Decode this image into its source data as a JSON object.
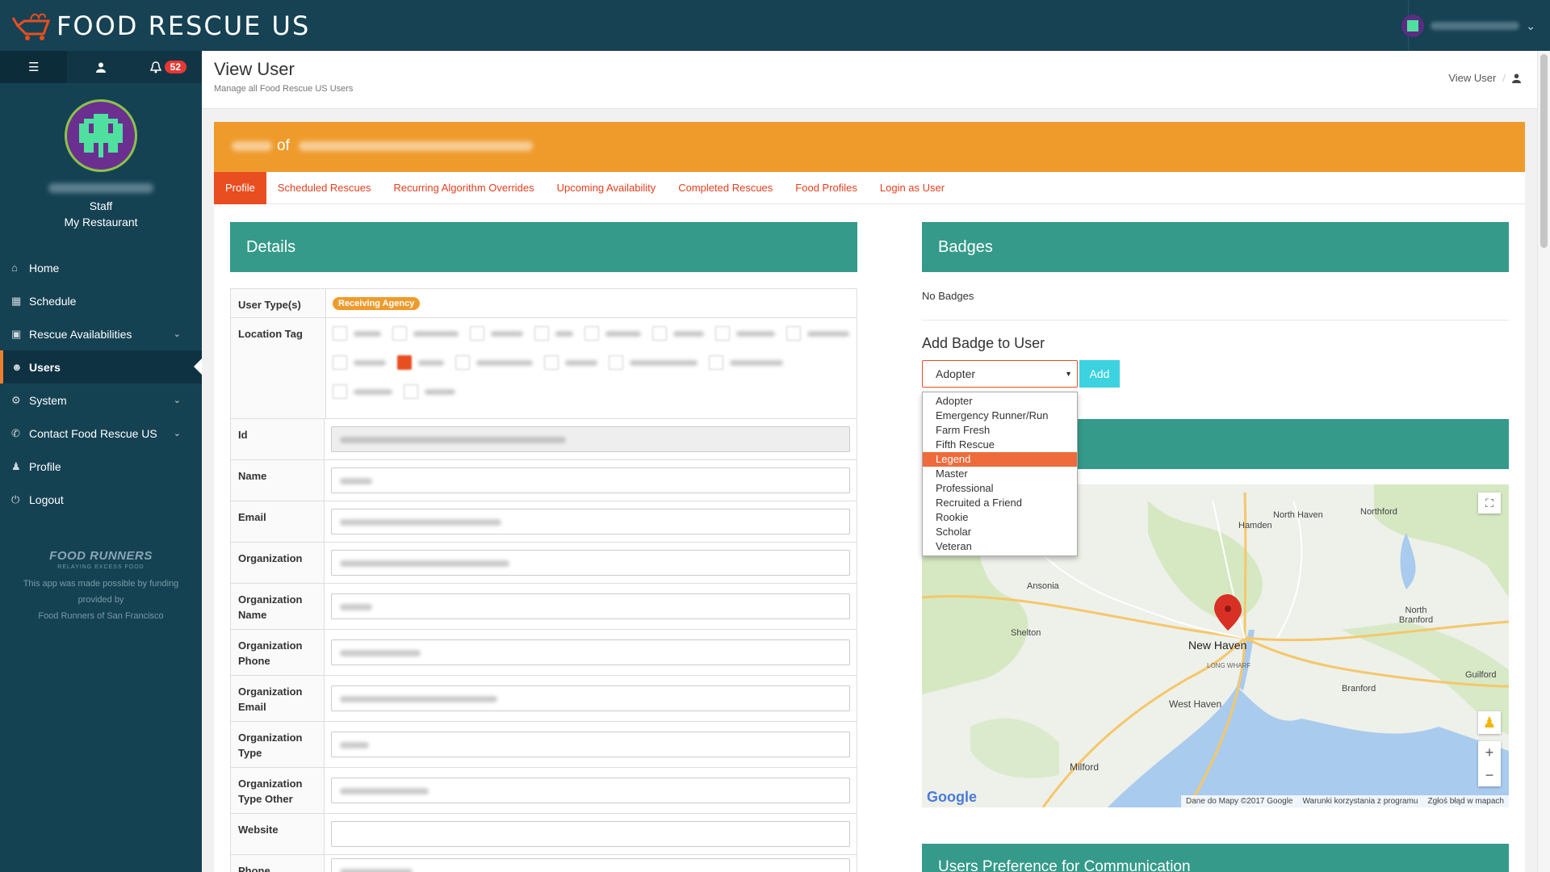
{
  "brand": {
    "name": "FOOD RESCUE US"
  },
  "topbar": {
    "notification_count": "52"
  },
  "sidebar": {
    "role": "Staff",
    "org": "My Restaurant",
    "items": [
      {
        "label": "Home",
        "icon": "home-icon"
      },
      {
        "label": "Schedule",
        "icon": "calendar-icon"
      },
      {
        "label": "Rescue Availabilities",
        "icon": "car-icon"
      },
      {
        "label": "Users",
        "icon": "users-icon"
      },
      {
        "label": "System",
        "icon": "gear-icon"
      },
      {
        "label": "Contact Food Rescue US",
        "icon": "phone-icon"
      },
      {
        "label": "Profile",
        "icon": "user-icon"
      },
      {
        "label": "Logout",
        "icon": "power-icon"
      }
    ],
    "footer": {
      "logo": "FOOD RUNNERS",
      "logo_sub": "RELAYING EXCESS FOOD",
      "line1": "This app was made possible by funding",
      "line2": "provided by",
      "line3": "Food Runners of San Francisco"
    }
  },
  "header": {
    "title": "View User",
    "subtitle": "Manage all Food Rescue US Users",
    "breadcrumb": "View User"
  },
  "banner": {
    "of": "of"
  },
  "tabs": [
    {
      "label": "Profile"
    },
    {
      "label": "Scheduled Rescues"
    },
    {
      "label": "Recurring Algorithm Overrides"
    },
    {
      "label": "Upcoming Availability"
    },
    {
      "label": "Completed Rescues"
    },
    {
      "label": "Food Profiles"
    },
    {
      "label": "Login as User"
    }
  ],
  "details": {
    "title": "Details",
    "labels": {
      "user_types": "User Type(s)",
      "location_tag": "Location Tag",
      "id": "Id",
      "name": "Name",
      "email": "Email",
      "organization": "Organization",
      "org_name": "Organization Name",
      "org_phone": "Organization Phone",
      "org_email": "Organization Email",
      "org_type": "Organization Type",
      "org_type_other": "Organization Type Other",
      "website": "Website",
      "phone": "Phone"
    },
    "user_type_value": "Receiving Agency"
  },
  "badges": {
    "title": "Badges",
    "empty": "No Badges",
    "add_title": "Add Badge to User",
    "selected": "Adopter",
    "add_label": "Add",
    "options": [
      "Adopter",
      "Emergency Runner/Run",
      "Farm Fresh",
      "Fifth Rescue",
      "Legend",
      "Master",
      "Professional",
      "Recruited a Friend",
      "Rookie",
      "Scholar",
      "Veteran"
    ],
    "highlighted": "Legend"
  },
  "map": {
    "places": [
      "North Haven",
      "Northford",
      "Hamden",
      "Ansonia",
      "Shelton",
      "New Haven",
      "North Branford",
      "Branford",
      "Guilford",
      "West Haven",
      "Milford",
      "LONG WHARF"
    ],
    "google": "Google",
    "attr1": "Dane do Mapy ©2017 Google",
    "attr2": "Warunki korzystania z programu",
    "attr3": "Zgłoś błąd w mapach"
  },
  "preferences": {
    "title": "Users Preference for Communication"
  },
  "colors": {
    "topbar": "#164253",
    "sidebar": "#154253",
    "accent": "#e84e20",
    "banner": "#ef9b2c",
    "panel": "#359a89",
    "add_button": "#3dd2e0"
  }
}
